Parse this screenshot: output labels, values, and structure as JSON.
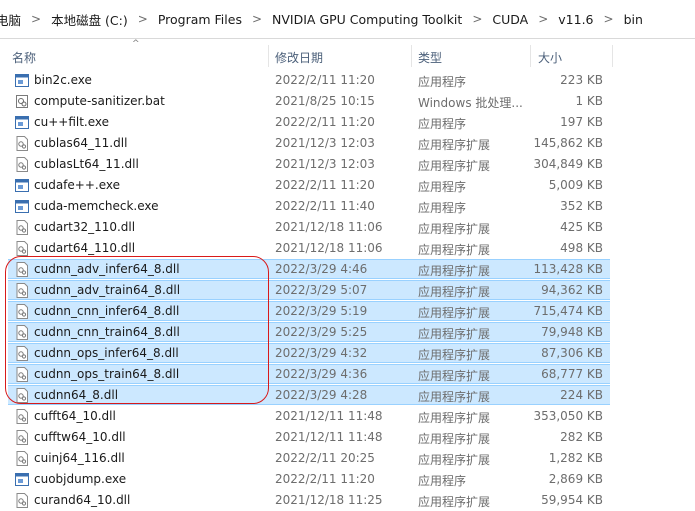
{
  "breadcrumb": [
    "电脑",
    "本地磁盘 (C:)",
    "Program Files",
    "NVIDIA GPU Computing Toolkit",
    "CUDA",
    "v11.6",
    "bin"
  ],
  "columns": {
    "name": "名称",
    "date": "修改日期",
    "type": "类型",
    "size": "大小"
  },
  "files": [
    {
      "name": "bin2c.exe",
      "date": "2022/2/11 11:20",
      "type": "应用程序",
      "size": "223 KB",
      "icon": "exe-icon",
      "selected": false
    },
    {
      "name": "compute-sanitizer.bat",
      "date": "2021/8/25 10:15",
      "type": "Windows 批处理...",
      "size": "1 KB",
      "icon": "bat-icon",
      "selected": false
    },
    {
      "name": "cu++filt.exe",
      "date": "2022/2/11 11:20",
      "type": "应用程序",
      "size": "197 KB",
      "icon": "exe-icon",
      "selected": false
    },
    {
      "name": "cublas64_11.dll",
      "date": "2021/12/3 12:03",
      "type": "应用程序扩展",
      "size": "145,862 KB",
      "icon": "dll-icon",
      "selected": false
    },
    {
      "name": "cublasLt64_11.dll",
      "date": "2021/12/3 12:03",
      "type": "应用程序扩展",
      "size": "304,849 KB",
      "icon": "dll-icon",
      "selected": false
    },
    {
      "name": "cudafe++.exe",
      "date": "2022/2/11 11:20",
      "type": "应用程序",
      "size": "5,009 KB",
      "icon": "exe-icon",
      "selected": false
    },
    {
      "name": "cuda-memcheck.exe",
      "date": "2022/2/11 11:40",
      "type": "应用程序",
      "size": "352 KB",
      "icon": "exe-icon",
      "selected": false
    },
    {
      "name": "cudart32_110.dll",
      "date": "2021/12/18 11:06",
      "type": "应用程序扩展",
      "size": "425 KB",
      "icon": "dll-icon",
      "selected": false
    },
    {
      "name": "cudart64_110.dll",
      "date": "2021/12/18 11:06",
      "type": "应用程序扩展",
      "size": "498 KB",
      "icon": "dll-icon",
      "selected": false
    },
    {
      "name": "cudnn_adv_infer64_8.dll",
      "date": "2022/3/29 4:46",
      "type": "应用程序扩展",
      "size": "113,428 KB",
      "icon": "dll-icon",
      "selected": true
    },
    {
      "name": "cudnn_adv_train64_8.dll",
      "date": "2022/3/29 5:07",
      "type": "应用程序扩展",
      "size": "94,362 KB",
      "icon": "dll-icon",
      "selected": true
    },
    {
      "name": "cudnn_cnn_infer64_8.dll",
      "date": "2022/3/29 5:19",
      "type": "应用程序扩展",
      "size": "715,474 KB",
      "icon": "dll-icon",
      "selected": true
    },
    {
      "name": "cudnn_cnn_train64_8.dll",
      "date": "2022/3/29 5:25",
      "type": "应用程序扩展",
      "size": "79,948 KB",
      "icon": "dll-icon",
      "selected": true
    },
    {
      "name": "cudnn_ops_infer64_8.dll",
      "date": "2022/3/29 4:32",
      "type": "应用程序扩展",
      "size": "87,306 KB",
      "icon": "dll-icon",
      "selected": true
    },
    {
      "name": "cudnn_ops_train64_8.dll",
      "date": "2022/3/29 4:36",
      "type": "应用程序扩展",
      "size": "68,777 KB",
      "icon": "dll-icon",
      "selected": true
    },
    {
      "name": "cudnn64_8.dll",
      "date": "2022/3/29 4:28",
      "type": "应用程序扩展",
      "size": "224 KB",
      "icon": "dll-icon",
      "selected": true
    },
    {
      "name": "cufft64_10.dll",
      "date": "2021/12/11 11:48",
      "type": "应用程序扩展",
      "size": "353,050 KB",
      "icon": "dll-icon",
      "selected": false
    },
    {
      "name": "cufftw64_10.dll",
      "date": "2021/12/11 11:48",
      "type": "应用程序扩展",
      "size": "282 KB",
      "icon": "dll-icon",
      "selected": false
    },
    {
      "name": "cuinj64_116.dll",
      "date": "2022/2/11 20:25",
      "type": "应用程序扩展",
      "size": "1,282 KB",
      "icon": "dll-icon",
      "selected": false
    },
    {
      "name": "cuobjdump.exe",
      "date": "2022/2/11 11:20",
      "type": "应用程序",
      "size": "2,869 KB",
      "icon": "exe-icon",
      "selected": false
    },
    {
      "name": "curand64_10.dll",
      "date": "2021/12/18 11:25",
      "type": "应用程序扩展",
      "size": "59,954 KB",
      "icon": "dll-icon",
      "selected": false
    }
  ],
  "colors": {
    "selection": "#cce8ff",
    "annotation": "#d81a1a"
  }
}
